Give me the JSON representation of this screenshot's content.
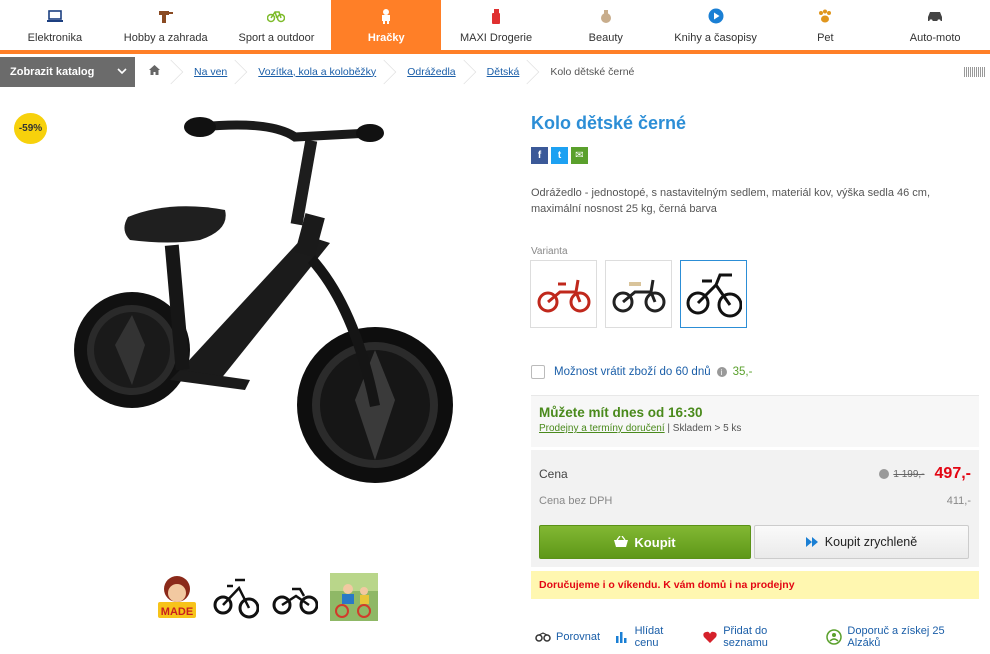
{
  "nav": {
    "categories": [
      {
        "label": "Elektronika",
        "icon": "laptop-icon"
      },
      {
        "label": "Hobby a zahrada",
        "icon": "drill-icon"
      },
      {
        "label": "Sport a outdoor",
        "icon": "bicycle-icon"
      },
      {
        "label": "Hračky",
        "icon": "toy-robot-icon",
        "active": true
      },
      {
        "label": "MAXI Drogerie",
        "icon": "spray-bottle-icon"
      },
      {
        "label": "Beauty",
        "icon": "perfume-icon"
      },
      {
        "label": "Knihy a časopisy",
        "icon": "play-circle-icon"
      },
      {
        "label": "Pet",
        "icon": "paw-icon"
      },
      {
        "label": "Auto-moto",
        "icon": "car-icon"
      }
    ],
    "accent": "#ff7f27"
  },
  "breadcrumb": {
    "catalog_button": "Zobrazit katalog",
    "items": [
      "Na ven",
      "Vozítka, kola a koloběžky",
      "Odrážedla",
      "Dětská"
    ],
    "current": "Kolo dětské černé"
  },
  "product": {
    "discount_badge": "-59%",
    "title": "Kolo dětské černé",
    "description": "Odrážedlo - jednostopé, s nastavitelným sedlem, materiál kov, výška sedla 46 cm, maximální nosnost 25 kg, černá barva",
    "variant_label": "Varianta",
    "variants": [
      "red",
      "black-beige",
      "black"
    ],
    "return_option": {
      "label": "Možnost vrátit zboží do 60 dnů",
      "price": "35,-"
    },
    "availability": {
      "headline": "Můžete mít dnes od 16:30",
      "link": "Prodejny a termíny doručení",
      "stock": " | Skladem > 5 ks"
    },
    "price": {
      "label": "Cena",
      "old": "1 199,-",
      "current": "497,-",
      "net_label": "Cena bez DPH",
      "net": "411,-"
    },
    "buy_button": "Koupit",
    "fast_buy_button": "Koupit zrychleně",
    "delivery_note": "Doručujeme i o víkendu. K vám domů i na prodejny",
    "actions": [
      {
        "label": "Porovnat",
        "icon": "compare-icon"
      },
      {
        "label": "Hlídat cenu",
        "icon": "price-watch-icon"
      },
      {
        "label": "Přidat do seznamu",
        "icon": "heart-icon"
      },
      {
        "label": "Doporuč a získej 25 Alzáků",
        "icon": "recommend-icon"
      }
    ]
  },
  "share": {
    "facebook": "f",
    "twitter": "t",
    "email": "✉"
  }
}
